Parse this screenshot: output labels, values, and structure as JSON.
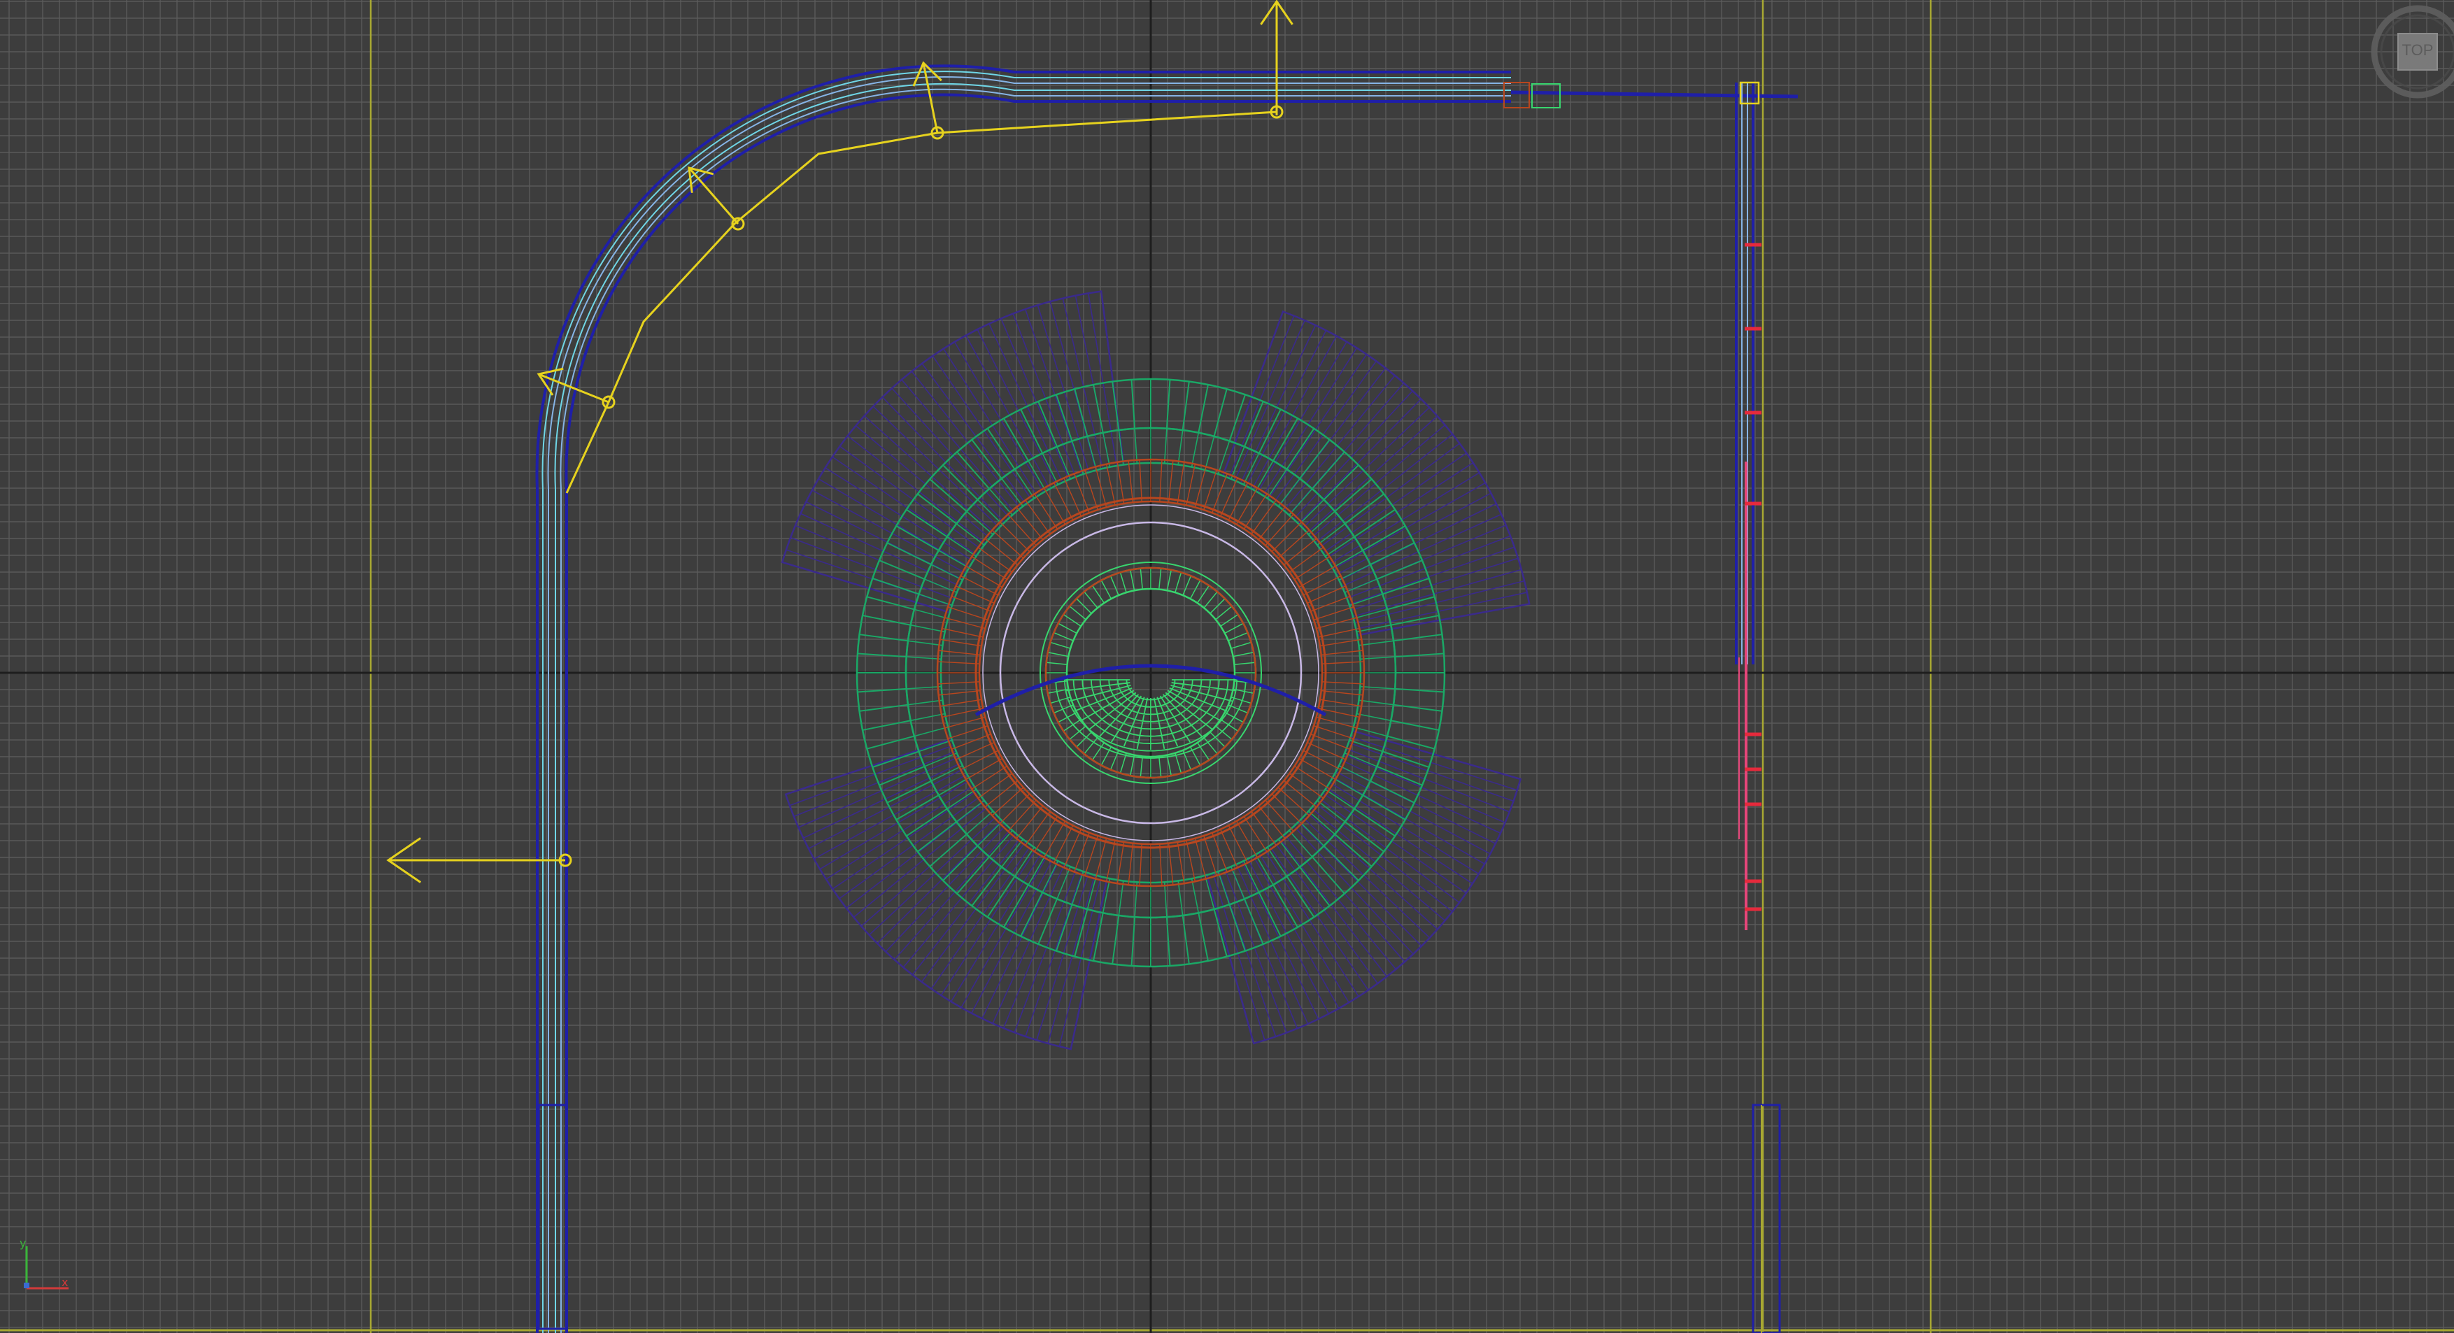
{
  "viewport": {
    "view_name": "Top",
    "view_label": "TOP",
    "render_mode": "wireframe"
  },
  "colors": {
    "background": "#3d3d3d",
    "grid_minor": "#5a5a5a",
    "grid_major": "#1e1e1e",
    "guide_yellow": "#a8a832",
    "rail_blue": "#1f1fa8",
    "rail_light": "#86b4e6",
    "rail_cyan": "#6fd6e6",
    "gizmo_yellow": "#e6d21e",
    "steps_purple": "#3a2a8c",
    "ring_green": "#1aa866",
    "ring_red": "#b8461e",
    "ring_white": "#c8b8e6",
    "inner_green": "#38d66e",
    "pink_rail": "#e6467a"
  },
  "icons": {
    "viewcube": "viewcube-icon",
    "axis_tripod": "axis-tripod-icon",
    "transform_gizmo": "move-gizmo-icon"
  },
  "axis_tripod": {
    "x_label": "x",
    "y_label": "y"
  }
}
